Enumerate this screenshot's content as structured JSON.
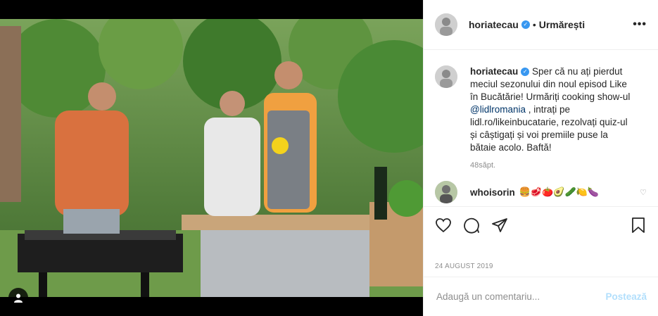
{
  "post": {
    "username": "horiatecau",
    "follow_dot": "•",
    "follow_label": "Urmărești",
    "more_label": "•••",
    "caption": {
      "username": "horiatecau",
      "text_1": "Sper că nu ați pierdut meciul sezonului din noul episod Like în Bucătărie! Urmăriți cooking show-ul ",
      "mention": "@lidlromania",
      "text_2": " , intrați pe lidl.ro/likeinbucatarie, rezolvați quiz-ul și câștigați și voi premiile puse la bătaie acolo. Baftă!",
      "time": "48săpt."
    },
    "comment": {
      "username": "whoisorin",
      "emojis": "🍔🥩🍅🥑🥒🍋🍆"
    },
    "date": "24 AUGUST 2019",
    "add_comment_placeholder": "Adaugă un comentariu...",
    "post_button": "Postează",
    "verified_mark": "✓"
  },
  "colors": {
    "accent": "#3897f0",
    "post_disabled": "#b2dffc",
    "muted": "#8e8e8e"
  },
  "icons": [
    "heart-icon",
    "comment-icon",
    "share-icon",
    "bookmark-icon",
    "user-tag-icon",
    "more-icon",
    "verified-icon"
  ]
}
